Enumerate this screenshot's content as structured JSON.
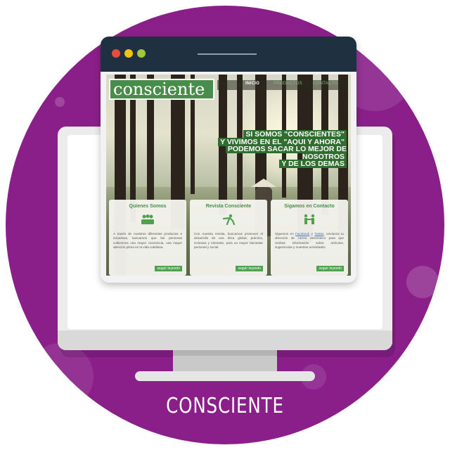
{
  "colors": {
    "background_circle": "#8a1f8a",
    "titlebar": "#1f3140",
    "brand_green": "#4a8c4a",
    "accent_green": "#4fa04f",
    "traffic_red": "#e74c3c",
    "traffic_yellow": "#f1c40f",
    "traffic_green": "#a4c639"
  },
  "site": {
    "logo_text": "consciente",
    "nav": {
      "inicio": "INICIO",
      "productos": "PRODUCTOS",
      "contacto": "CONTACTO"
    },
    "headline": {
      "line1": "SI SOMOS \"CONSCIENTES\"",
      "line2": "Y VIVIMOS EN EL \"AQUI Y AHORA\"",
      "line3": "PODEMOS SACAR LO MEJOR DE NOSOTROS",
      "line4": "Y DE LOS DEMAS"
    },
    "cards": [
      {
        "title": "Quienes Somos",
        "icon": "people-icon",
        "text": "A través de nuestros diferentes productos e iniciativas, buscamos que las personas cultivemos una mayor conciencia, una mayor atención plena en la vida cotidiana.",
        "more": "seguir leyendo"
      },
      {
        "title": "Revista Consciente",
        "icon": "person-figure-icon",
        "text": "Con nuestra revista, buscamos promover el desarrollo de una ética global, práctica, inclusiva y tolerante, para un mayor bienestar personal y social.",
        "more": "seguir leyendo"
      },
      {
        "title": "Sigamos en Contacto",
        "icon": "handshake-icon",
        "text_before": "Siguenos en ",
        "link1": "Facebook",
        "text_mid": " y ",
        "link2": "Twitter",
        "text_after": ", envíanos tu dirección de correo electrónico para que recibas información sobre artículos, sugerencias y nuestras actividades.",
        "more": "seguir leyendo"
      }
    ]
  },
  "caption": "CONSCIENTE"
}
